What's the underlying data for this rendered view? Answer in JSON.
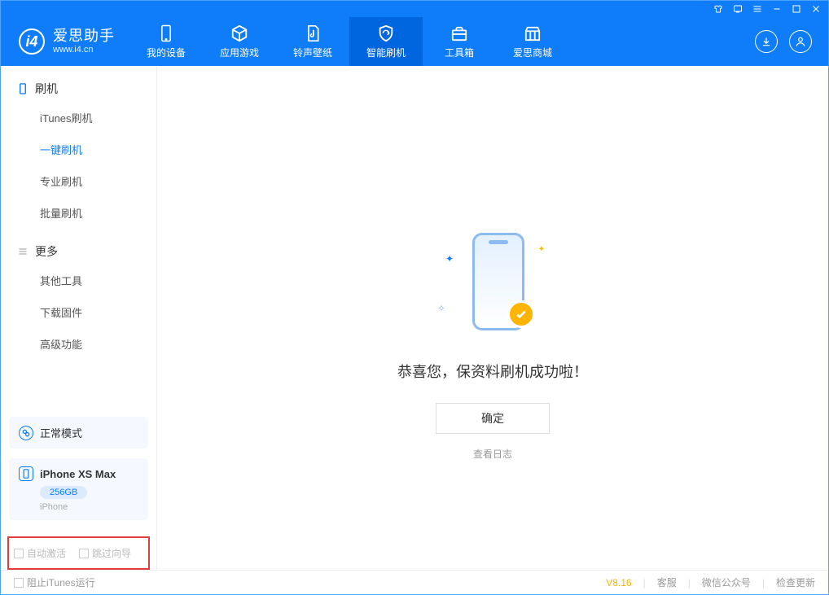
{
  "brand": {
    "title": "爱思助手",
    "subtitle": "www.i4.cn"
  },
  "nav": {
    "items": [
      {
        "label": "我的设备"
      },
      {
        "label": "应用游戏"
      },
      {
        "label": "铃声壁纸"
      },
      {
        "label": "智能刷机"
      },
      {
        "label": "工具箱"
      },
      {
        "label": "爱思商城"
      }
    ],
    "active_index": 3
  },
  "sidebar": {
    "group1": {
      "title": "刷机",
      "items": [
        "iTunes刷机",
        "一键刷机",
        "专业刷机",
        "批量刷机"
      ],
      "active_index": 1
    },
    "group2": {
      "title": "更多",
      "items": [
        "其他工具",
        "下载固件",
        "高级功能"
      ]
    },
    "mode_card": {
      "label": "正常模式"
    },
    "device": {
      "name": "iPhone XS Max",
      "capacity": "256GB",
      "type": "iPhone"
    },
    "options": {
      "auto_activate": "自动激活",
      "skip_guide": "跳过向导"
    }
  },
  "main": {
    "success_text": "恭喜您，保资料刷机成功啦！",
    "confirm_label": "确定",
    "view_log_label": "查看日志"
  },
  "statusbar": {
    "block_itunes": "阻止iTunes运行",
    "version": "V8.16",
    "links": [
      "客服",
      "微信公众号",
      "检查更新"
    ]
  }
}
